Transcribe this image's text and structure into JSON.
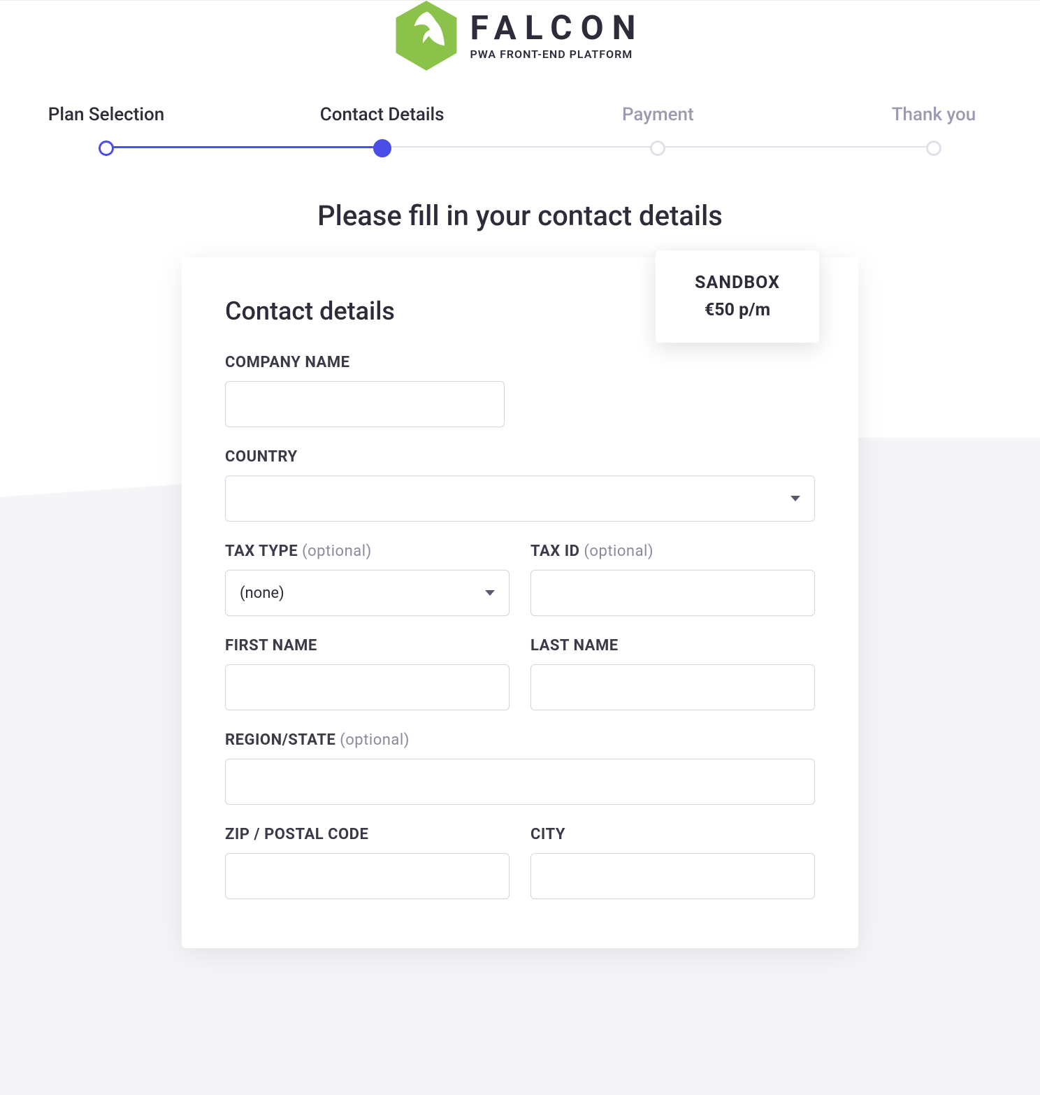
{
  "logo": {
    "brand": "FALCON",
    "tagline": "PWA FRONT-END PLATFORM"
  },
  "stepper": {
    "steps": [
      {
        "label": "Plan Selection",
        "state": "done"
      },
      {
        "label": "Contact Details",
        "state": "active"
      },
      {
        "label": "Payment",
        "state": "future"
      },
      {
        "label": "Thank you",
        "state": "future"
      }
    ]
  },
  "page_title": "Please fill in your contact details",
  "plan_badge": {
    "name": "SANDBOX",
    "price": "€50 p/m"
  },
  "form": {
    "heading": "Contact details",
    "labels": {
      "company_name": "COMPANY NAME",
      "country": "COUNTRY",
      "tax_type": "TAX TYPE",
      "tax_id": "TAX ID",
      "first_name": "FIRST NAME",
      "last_name": "LAST NAME",
      "region_state": "REGION/STATE",
      "zip": "ZIP / POSTAL CODE",
      "city": "CITY",
      "optional": "(optional)"
    },
    "values": {
      "company_name": "",
      "country": "",
      "tax_type": "(none)",
      "tax_id": "",
      "first_name": "",
      "last_name": "",
      "region_state": "",
      "zip": "",
      "city": ""
    }
  }
}
